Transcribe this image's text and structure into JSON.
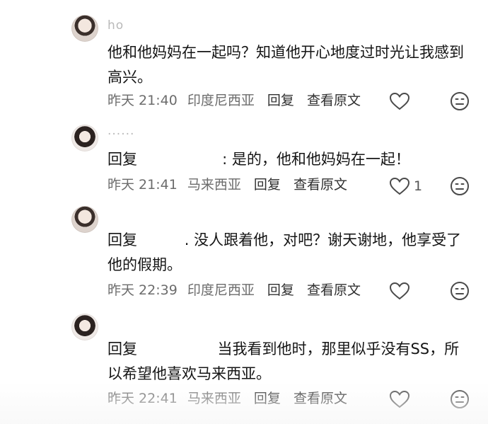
{
  "comments": [
    {
      "username": "ho",
      "text": "他和他妈妈在一起吗？知道他开心地度过时光让我感到高兴。",
      "time": "昨天 21:40",
      "location": "印度尼西亚",
      "reply_label": "回复",
      "view_original_label": "查看原文",
      "likes": ""
    },
    {
      "username": "......",
      "text": "回复                  : 是的，他和他妈妈在一起！",
      "time": "昨天 21:41",
      "location": "马来西亚",
      "reply_label": "回复",
      "view_original_label": "查看原文",
      "likes": "1"
    },
    {
      "username": "",
      "text": "回复          . 没人跟着他，对吧？谢天谢地，他享受了他的假期。",
      "time": "昨天 22:39",
      "location": "印度尼西亚",
      "reply_label": "回复",
      "view_original_label": "查看原文",
      "likes": ""
    },
    {
      "username": "",
      "text": "回复                 当我看到他时，那里似乎没有SS，所以希望他喜欢马来西亚。",
      "time": "昨天 22:41",
      "location": "马来西亚",
      "reply_label": "回复",
      "view_original_label": "查看原文",
      "likes": ""
    }
  ],
  "icons": {
    "like": "heart-outline",
    "dislike": "neutral-face"
  },
  "colors": {
    "text": "#151515",
    "meta": "#6c6c6c",
    "icon": "#4a4a4a"
  }
}
